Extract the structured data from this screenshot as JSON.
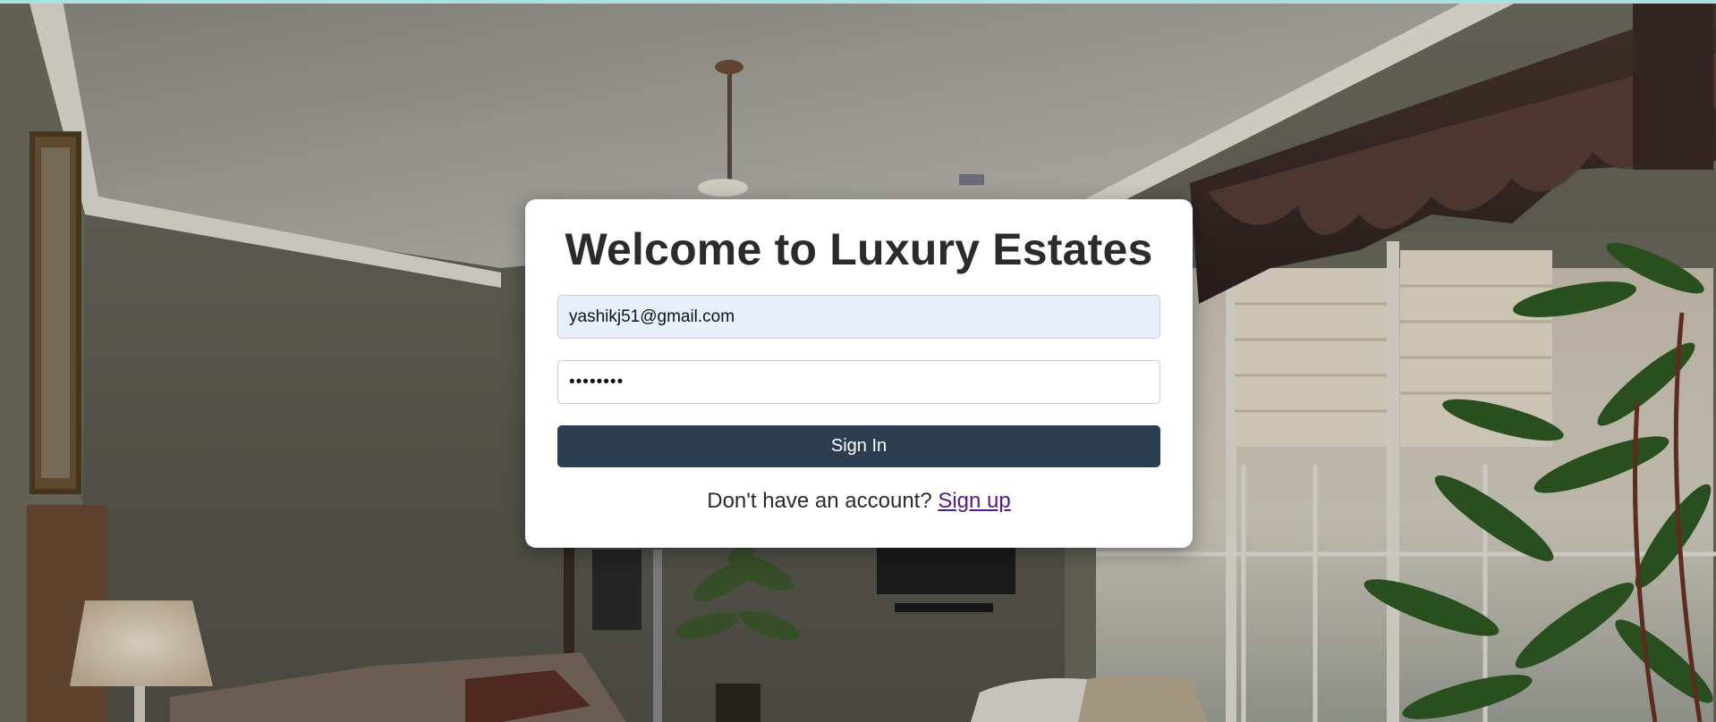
{
  "login": {
    "title": "Welcome to Luxury Estates",
    "email_value": "yashikj51@gmail.com",
    "password_value": "••••••••",
    "signin_label": "Sign In",
    "signup_prompt": "Don't have an account?",
    "signup_link": "Sign up"
  },
  "background": {
    "scene": "bedroom-interior-photo",
    "elements": [
      "ceiling-fan",
      "curtain-valance",
      "window-shades",
      "potted-plant",
      "bed",
      "table-lamp",
      "wall-tv",
      "armchair"
    ]
  },
  "colors": {
    "accent_strip": "#a9e1df",
    "button": "#2c3e50",
    "email_field_bg": "#e8eefc",
    "link": "#551a8b",
    "title": "#2b2b2b"
  }
}
